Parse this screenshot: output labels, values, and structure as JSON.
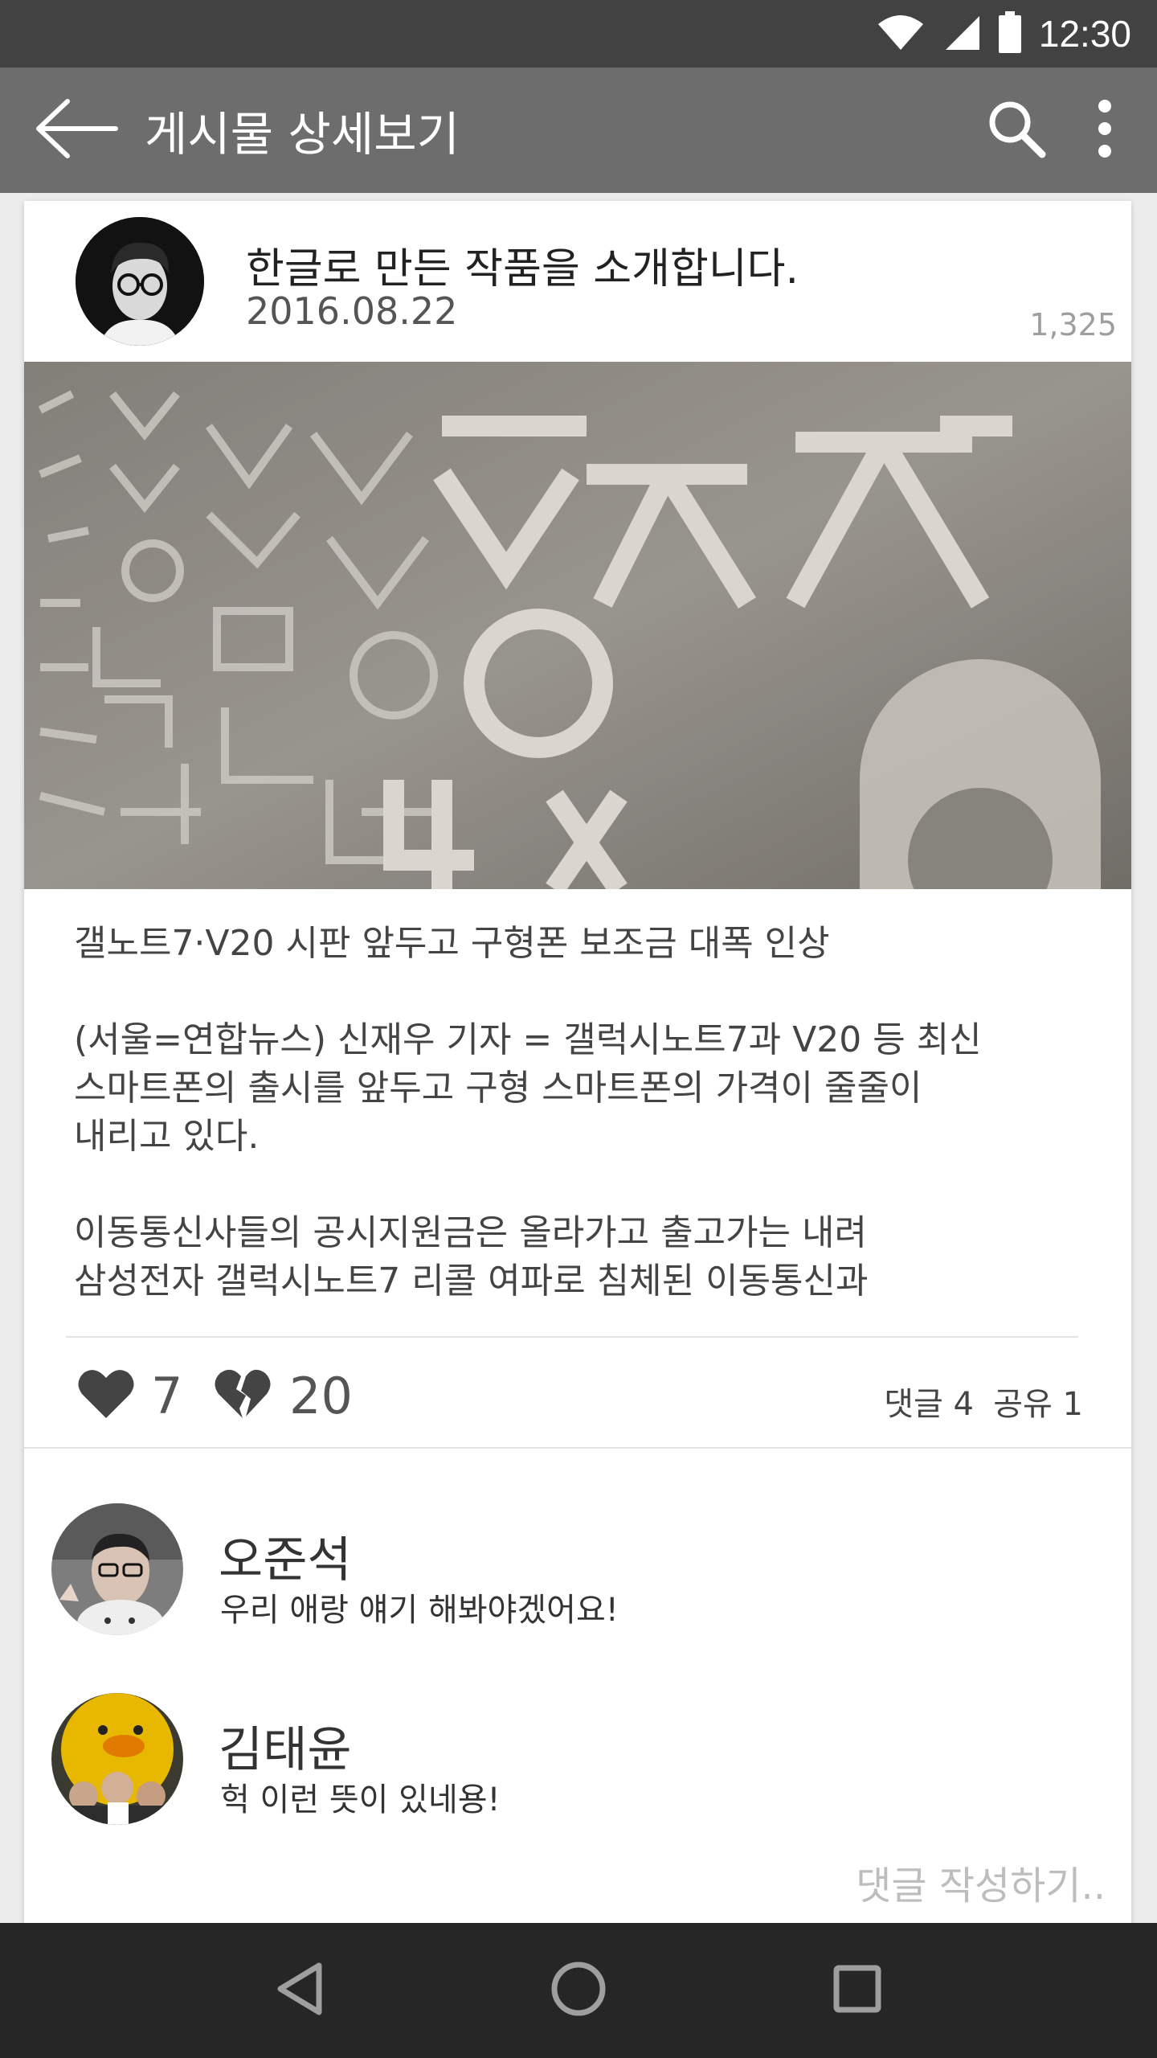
{
  "status_bar": {
    "time": "12:30",
    "icons": [
      "wifi-icon",
      "cell-signal-icon",
      "battery-icon"
    ]
  },
  "app_bar": {
    "title": "게시물 상세보기",
    "back_icon": "arrow-left-icon",
    "actions": [
      "search-icon",
      "more-vert-icon"
    ]
  },
  "post": {
    "title": "한글로 만든 작품을 소개합니다.",
    "date": "2016.08.22",
    "views": "1,325",
    "body": "갤노트7·V20 시판 앞두고 구형폰 보조금 대폭 인상\n\n(서울=연합뉴스) 신재우 기자 = 갤럭시노트7과 V20 등 최신\n스마트폰의 출시를 앞두고 구형 스마트폰의 가격이 줄줄이\n내리고 있다.\n\n이동통신사들의 공시지원금은 올라가고 출고가는 내려\n삼성전자 갤럭시노트7 리콜 여파로 침체된 이동통신과",
    "likes": "7",
    "dislikes": "20",
    "comment_count": "댓글 4",
    "share_count": "공유 1"
  },
  "comments": [
    {
      "name": "오준석",
      "text": "우리 애랑 얘기 해봐야겠어요!"
    },
    {
      "name": "김태윤",
      "text": "헉 이런 뜻이 있네용!"
    }
  ],
  "write_comment_placeholder": "댓글 작성하기..",
  "colors": {
    "status_bar": "#424242",
    "app_bar": "#6d6d6d",
    "nav_bar": "#262626",
    "background": "#ececec"
  }
}
